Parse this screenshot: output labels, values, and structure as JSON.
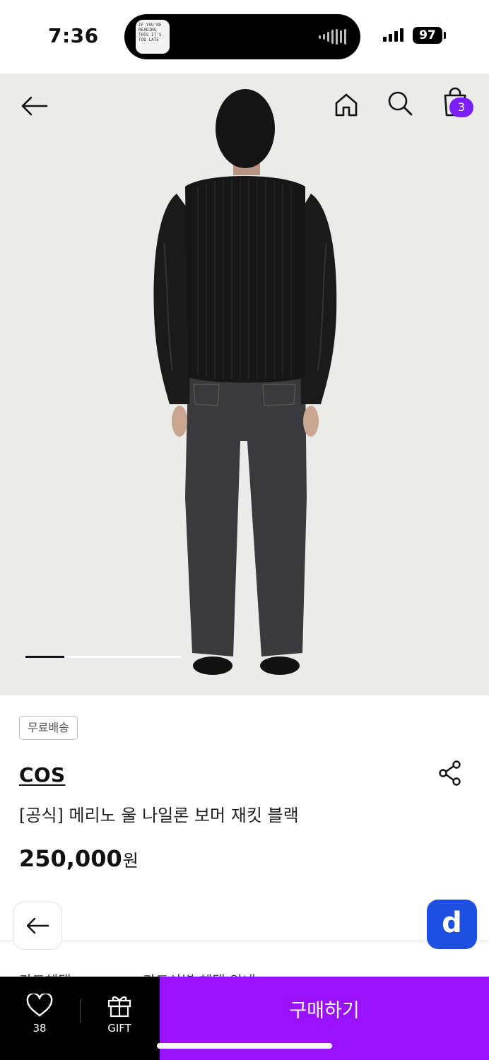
{
  "status": {
    "time": "7:36",
    "battery": "97",
    "island_art_text": "IF YOU'RE READING THIS IT'S TOO LATE"
  },
  "nav": {
    "back_icon": "arrow-left-icon",
    "home_icon": "home-icon",
    "search_icon": "search-icon",
    "cart_icon": "shopping-bag-icon",
    "cart_count": "3"
  },
  "gallery": {
    "progress_fraction": 0.25
  },
  "product": {
    "shipping_badge": "무료배송",
    "brand": "COS",
    "name": "[공식] 메리노 울 나일론 보머 재킷 블랙",
    "price": "250,000",
    "price_unit": "원"
  },
  "peek": {
    "left_text": "카드혜택",
    "mid_text": "카드사별 혜택 안내"
  },
  "bottom_bar": {
    "wish_count": "38",
    "gift_label": "GIFT",
    "buy_label": "구매하기"
  },
  "colors": {
    "accent_purple": "#9a12ff",
    "badge_purple": "#7b1fff",
    "floating_blue": "#1f4fe0"
  }
}
